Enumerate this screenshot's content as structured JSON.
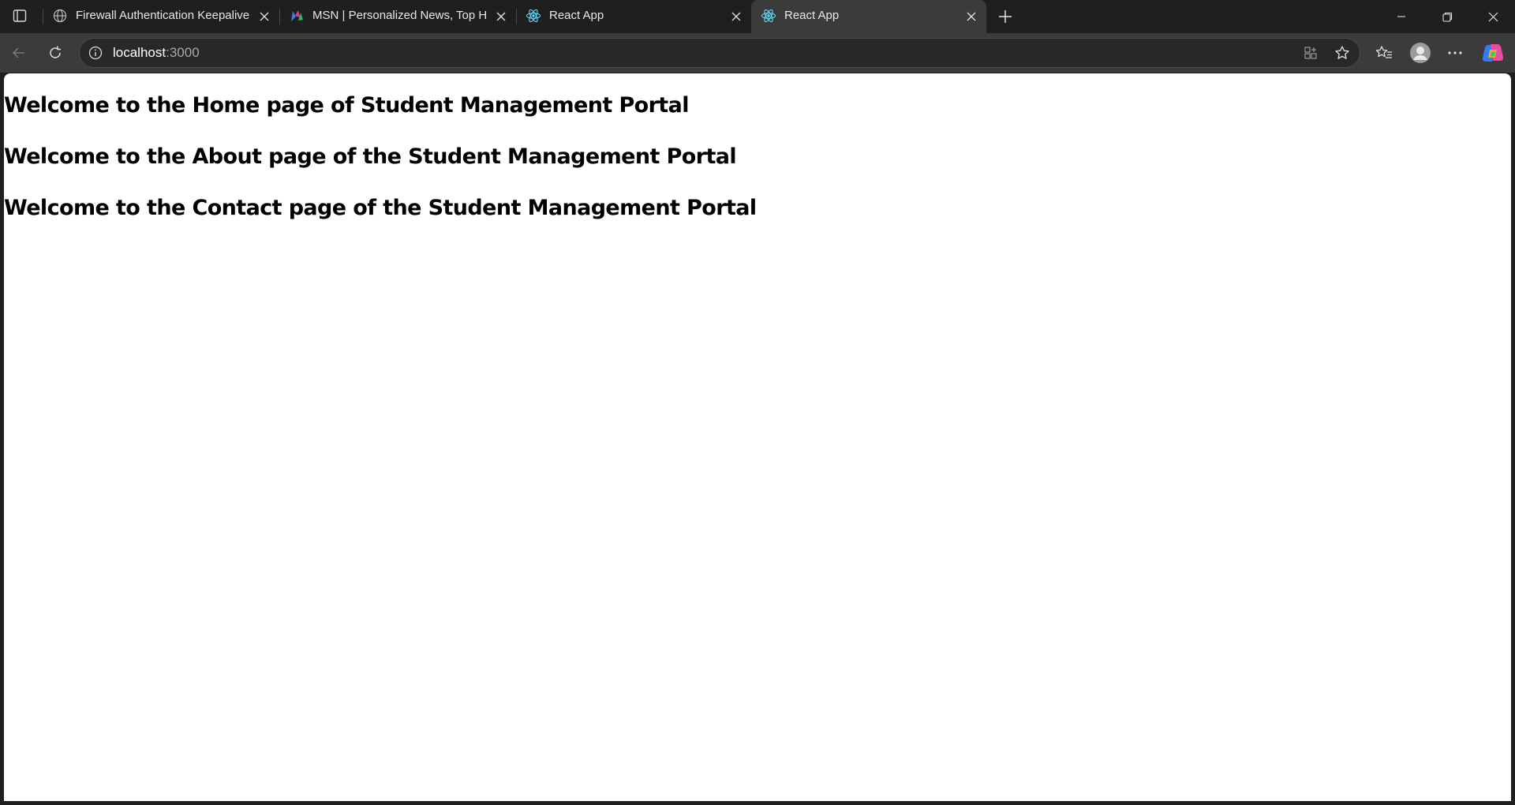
{
  "browser": {
    "tabs": [
      {
        "title": "Firewall Authentication Keepalive",
        "icon": "globe-icon",
        "active": false
      },
      {
        "title": "MSN | Personalized News, Top He",
        "icon": "msn-icon",
        "active": false
      },
      {
        "title": "React App",
        "icon": "react-icon",
        "active": false
      },
      {
        "title": "React App",
        "icon": "react-icon",
        "active": true
      }
    ],
    "address": {
      "host": "localhost",
      "port": ":3000"
    }
  },
  "page": {
    "headings": [
      "Welcome to the Home page of Student Management Portal",
      "Welcome to the About page of the Student Management Portal",
      "Welcome to the Contact page of the Student Management Portal"
    ]
  },
  "colors": {
    "chrome_bg": "#1f1f1f",
    "toolbar_bg": "#3b3b3b",
    "page_bg": "#ffffff",
    "react_accent": "#61dafb"
  }
}
